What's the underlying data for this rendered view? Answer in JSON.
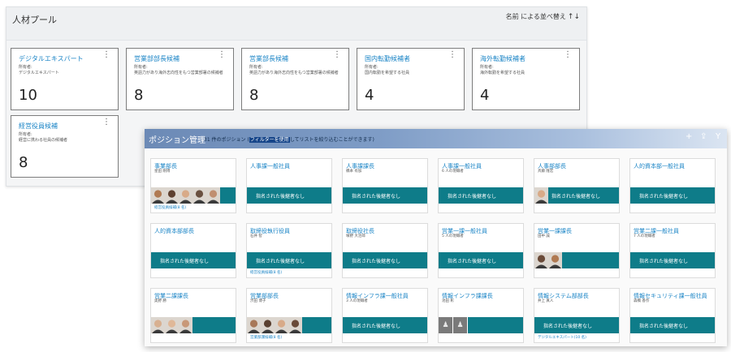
{
  "talent_pool": {
    "title": "人材プール",
    "sort_label": "名前 による並べ替え",
    "sort_icon": "↑↓",
    "menu_icon": "⋮",
    "cards": [
      {
        "title": "デジタルエキスパート",
        "owner_label": "所有者:",
        "description": "デジタルエキスパート",
        "count": "10"
      },
      {
        "title": "営業部部長候補",
        "owner_label": "所有者:",
        "description": "英語力があり海外志向性をもつ営業部署の候補者",
        "count": "8"
      },
      {
        "title": "営業部長候補",
        "owner_label": "所有者:",
        "description": "英語力があり海外志向性をもつ営業部署の候補者",
        "count": "8"
      },
      {
        "title": "国内転勤候補者",
        "owner_label": "所有者:",
        "description": "国内転勤を希望する社員",
        "count": "4"
      },
      {
        "title": "海外転勤候補者",
        "owner_label": "所有者:",
        "description": "海外転勤を希望する社員",
        "count": "4"
      },
      {
        "title": "経営役員候補",
        "owner_label": "所有者:",
        "description": "経営に携わる社員の候補者",
        "count": "8"
      }
    ]
  },
  "positions": {
    "title": "ポジション管理",
    "subtitle_pre": "31 件のポジション (",
    "subtitle_link": "フィルターを使用",
    "subtitle_post": "してリストを絞り込むことができます)",
    "add_icon": "+",
    "export_icon": "⇪",
    "filter_icon": "Y",
    "no_successor": "指名された後継者なし",
    "cards": [
      {
        "title": "事業部長",
        "sub": "星田 剛博",
        "avatars": [
          "#b07a52",
          "#5e4030",
          "#d8aa88",
          "#6a5040",
          "#c08e70"
        ],
        "link": "経営役員候補(8 名)"
      },
      {
        "title": "人事課一般社員",
        "sub": "",
        "bar": true
      },
      {
        "title": "人事課課長",
        "sub": "橋本 有加",
        "bar": true
      },
      {
        "title": "人事課一般社員",
        "sub": "6 人の現職者",
        "bar": true
      },
      {
        "title": "人事部部長",
        "sub": "斉藤 隆宏",
        "bar": true,
        "avatars": [
          "#d8aa88"
        ]
      },
      {
        "title": "人的資本部一般社員",
        "sub": "",
        "bar": true
      },
      {
        "title": "人的資本部部長",
        "sub": "",
        "bar": true
      },
      {
        "title": "取締役執行役員",
        "sub": "石井 智",
        "bar": true,
        "link": "経営役員候補(8 名)"
      },
      {
        "title": "取締役社長",
        "sub": "塚野 大治郎",
        "bar": true
      },
      {
        "title": "営業一課一般社員",
        "sub": "5 人の現職者",
        "bar": true
      },
      {
        "title": "営業一課課長",
        "sub": "田中 誠",
        "avatars": [
          "#6a4a38",
          "#b07a52"
        ]
      },
      {
        "title": "営業二課一般社員",
        "sub": "7 人の現職者",
        "bar": true
      },
      {
        "title": "営業二課課長",
        "sub": "奥野 勝",
        "avatars": [
          "#d8b090",
          "#e0b898",
          "#c89878"
        ]
      },
      {
        "title": "営業部部長",
        "sub": "渋田 博子",
        "avatars": [
          "#a87858",
          "#5a4030",
          "#d8aa88",
          "#6a4a38"
        ],
        "link": "営業部課候補(8 名)"
      },
      {
        "title": "情報インフラ課一般社員",
        "sub": "3 人の現職者",
        "bar": true
      },
      {
        "title": "情報インフラ課課長",
        "sub": "池田 彰",
        "placeholders": 2
      },
      {
        "title": "情報システム部部長",
        "sub": "井上 真人",
        "bar": true,
        "link": "デジタルエキスパート(10 名)"
      },
      {
        "title": "情報セキュリティ課一般社員",
        "sub": "森橋 香奈",
        "bar": true
      }
    ]
  },
  "colors": {
    "accent": "#1a84c6",
    "teal": "#0e7c89",
    "border": "#7d7d7d"
  }
}
